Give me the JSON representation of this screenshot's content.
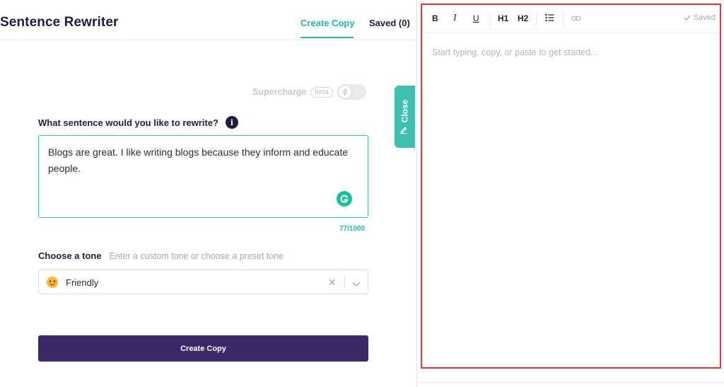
{
  "header": {
    "title": "Sentence Rewriter",
    "tabs": [
      {
        "label": "Create Copy",
        "active": true
      },
      {
        "label": "Saved (0)",
        "active": false
      }
    ]
  },
  "supercharge": {
    "label": "Supercharge",
    "badge": "beta",
    "enabled": false
  },
  "close_tab": {
    "label": "Close",
    "icon": "pencil-icon"
  },
  "form": {
    "question_label": "What sentence would you like to rewrite?",
    "info_glyph": "i",
    "sentence_value": "Blogs are great. I like writing blogs because they inform and educate people.",
    "char_count": "77/1000",
    "tone_label": "Choose a tone",
    "tone_hint": "Enter a custom tone or choose a preset tone",
    "tone_value": "Friendly",
    "tone_emoji": "smiling-face-icon",
    "submit_label": "Create Copy"
  },
  "editor": {
    "toolbar": {
      "bold": "B",
      "italic": "I",
      "underline": "U",
      "h1": "H1",
      "h2": "H2",
      "list_icon": "bullet-list-icon",
      "link_icon": "link-icon"
    },
    "status": "Saved",
    "placeholder": "Start typing, copy, or paste to get started..."
  },
  "colors": {
    "accent": "#21b6a8",
    "primary_button": "#3b2867",
    "highlight_border": "#e8362a",
    "title": "#1f1d3b"
  }
}
